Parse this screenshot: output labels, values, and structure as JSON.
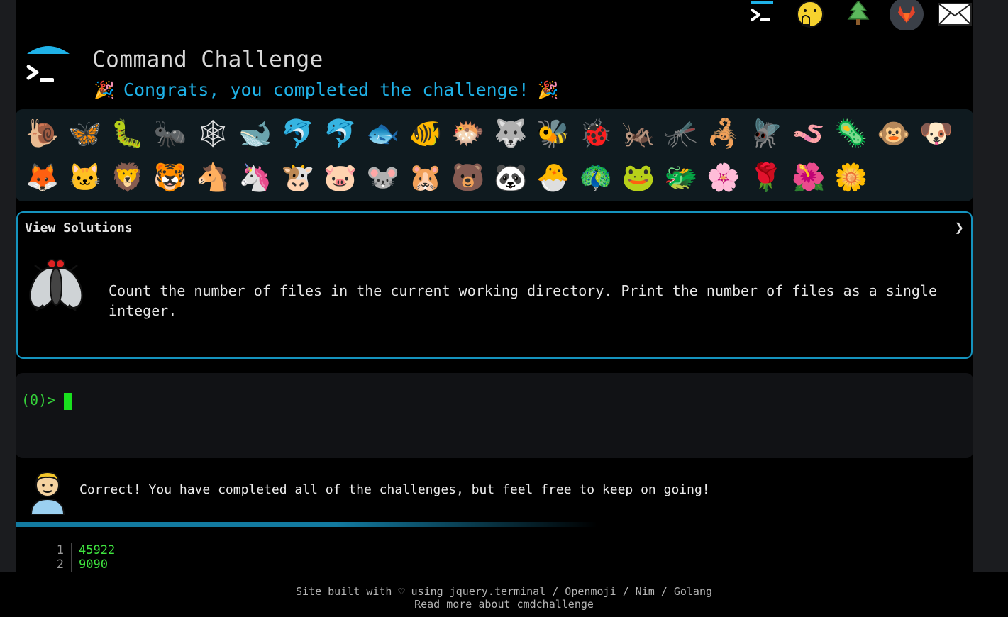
{
  "header": {
    "title": "Command Challenge",
    "congrats": "Congrats, you completed the challenge!",
    "party_icon": "🎉"
  },
  "topnav": {
    "items": [
      {
        "name": "terminal-logo-icon",
        "glyph": "terminal"
      },
      {
        "name": "face-hand-over-mouth-icon",
        "glyph": "🫢"
      },
      {
        "name": "christmas-tree-icon",
        "glyph": "🌲"
      },
      {
        "name": "gitlab-icon",
        "glyph": "gitlab"
      },
      {
        "name": "envelope-icon",
        "glyph": "✉"
      }
    ]
  },
  "emoji_strip": {
    "row1": [
      "🐌",
      "🦋",
      "🐛",
      "🐜",
      "🕸",
      "🐋",
      "🐬",
      "🐬",
      "🐟",
      "🐠",
      "🐡",
      "🐺",
      "🐝",
      "🐞",
      "🦗",
      "🦟",
      "🦂",
      "🪰",
      "🪱",
      "🦠",
      "🐵",
      "🐶"
    ],
    "row2": [
      "🦊",
      "🐱",
      "🦁",
      "🐯",
      "🐴",
      "🦄",
      "🐮",
      "🐷",
      "🐭",
      "🐹",
      "🐻",
      "🐼",
      "🐣",
      "🦚",
      "🐸",
      "🐲",
      "🌸",
      "🌹",
      "🌺",
      "🌼"
    ]
  },
  "solutions": {
    "label": "View Solutions",
    "chevron": "❯",
    "icon": "🪰",
    "description": "Count the number of files in the current working directory. Print the number of files as a single integer."
  },
  "terminal": {
    "prompt": "(0)>"
  },
  "result": {
    "avatar": "👨",
    "message": "Correct! You have completed all of the challenges, but feel free to keep on going!"
  },
  "output": {
    "lines": [
      {
        "n": "1",
        "v": "45922"
      },
      {
        "n": "2",
        "v": "9090"
      }
    ]
  },
  "footer": {
    "line1": "Site built with ♡ using jquery.terminal / Openmoji / Nim / Golang",
    "line2": "Read more about cmdchallenge"
  },
  "colors": {
    "accent": "#1fb2e8",
    "panel_border": "#1593be",
    "prompt_green": "#35d13a"
  }
}
